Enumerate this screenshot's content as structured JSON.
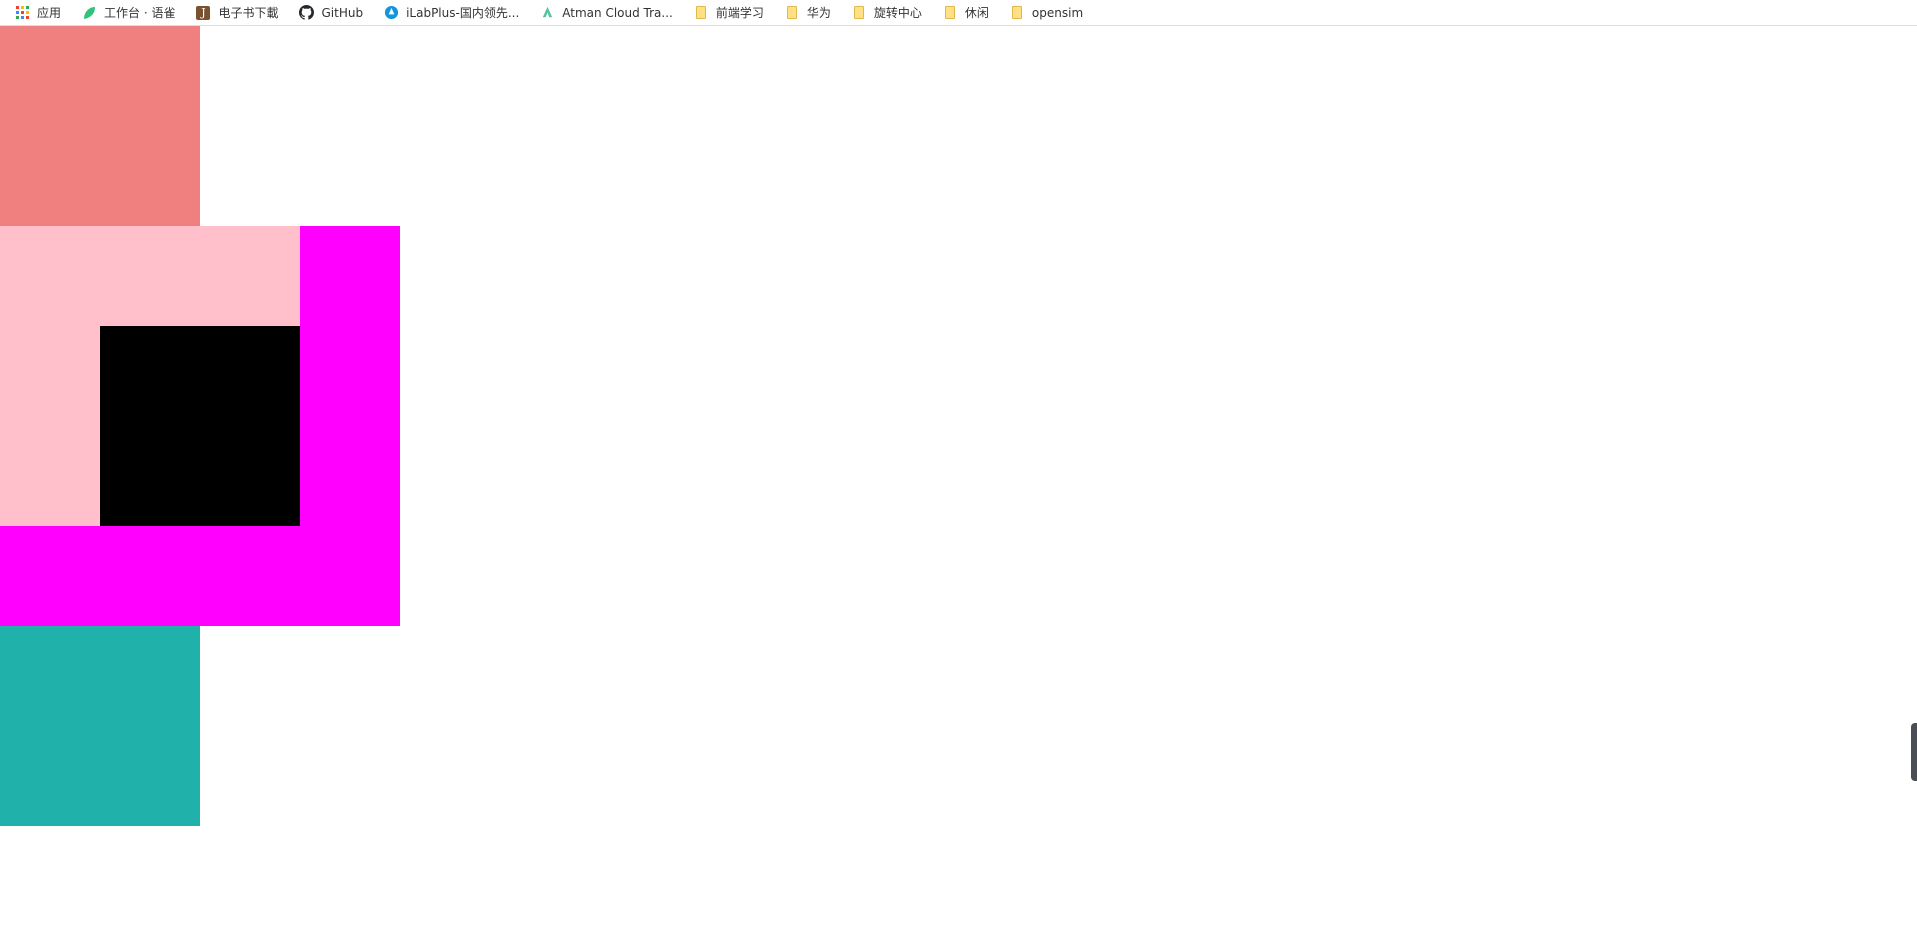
{
  "bookmarks": [
    {
      "label": "应用",
      "icon": "apps-grid-icon"
    },
    {
      "label": "工作台 · 语雀",
      "icon": "yuque-leaf-icon"
    },
    {
      "label": "电子书下載",
      "icon": "j-book-icon",
      "glyph": "J"
    },
    {
      "label": "GitHub",
      "icon": "github-icon"
    },
    {
      "label": "iLabPlus-国内领先...",
      "icon": "ilab-drop-icon"
    },
    {
      "label": "Atman Cloud Tra...",
      "icon": "atman-icon"
    },
    {
      "label": "前端学习",
      "icon": "folder-icon"
    },
    {
      "label": "华为",
      "icon": "folder-icon"
    },
    {
      "label": "旋转中心",
      "icon": "folder-icon"
    },
    {
      "label": "休闲",
      "icon": "folder-icon"
    },
    {
      "label": "opensim",
      "icon": "folder-icon"
    }
  ],
  "colors": {
    "top_box": "#f08080",
    "frame": "#ff00ff",
    "pink": "#ffc0cb",
    "black": "#000000",
    "bottom_box": "#20b2aa",
    "apps_dots": [
      "#ea4335",
      "#fbbc05",
      "#34a853",
      "#4285f4",
      "#ea4335",
      "#fbbc05",
      "#34a853",
      "#4285f4",
      "#ea4335"
    ],
    "yuque": "#31c27c",
    "ilab": "#1296db",
    "atman": "#4fc3a1",
    "github": "#24292e"
  }
}
